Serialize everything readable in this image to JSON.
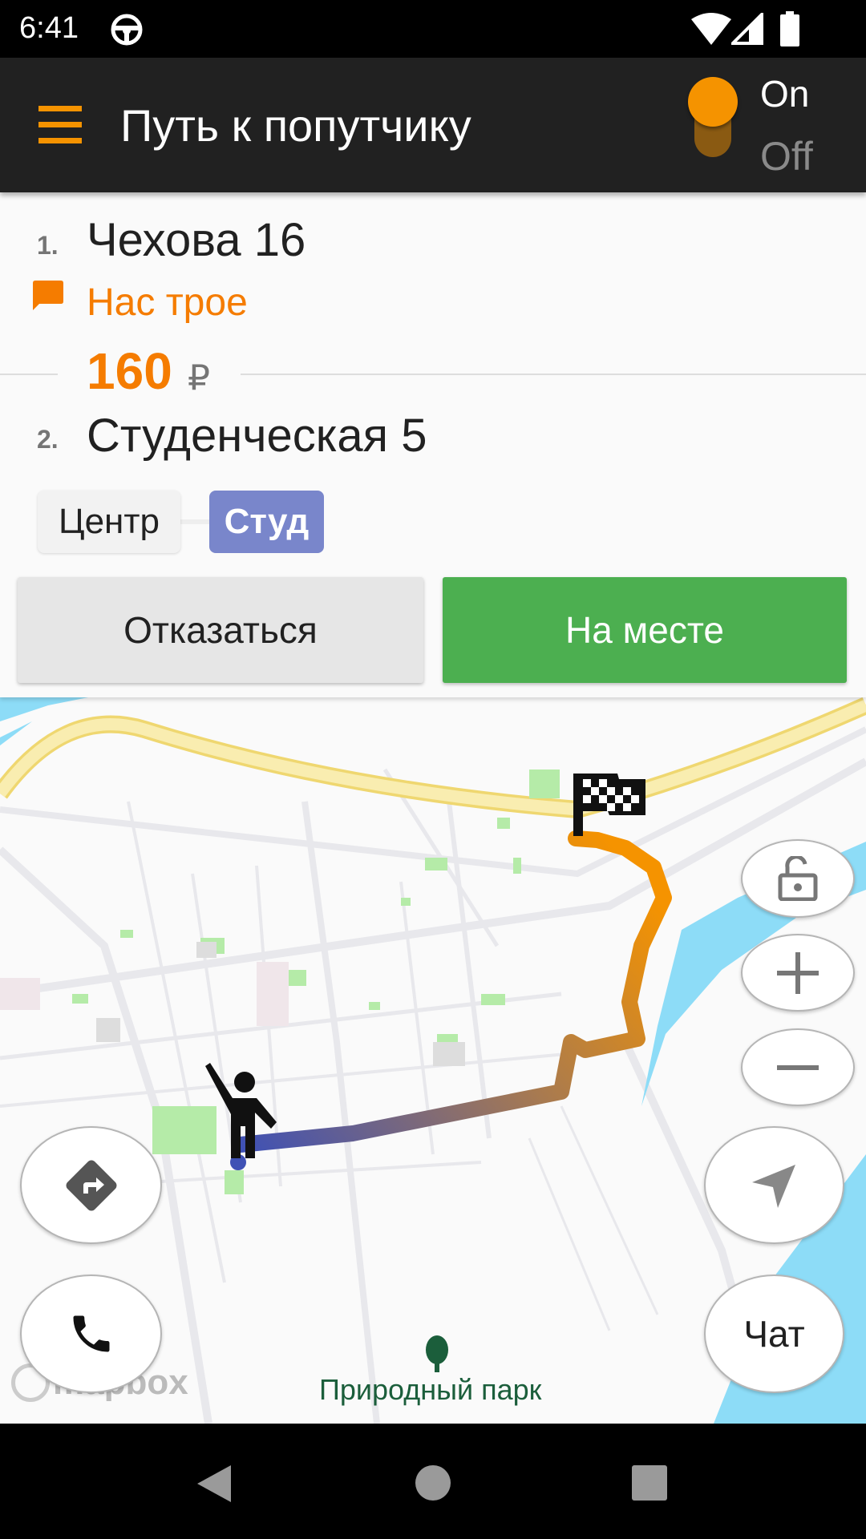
{
  "status_bar": {
    "time": "6:41",
    "icons": [
      "steering-wheel-icon",
      "wifi-icon",
      "signal-icon",
      "battery-icon"
    ]
  },
  "app_bar": {
    "title": "Путь к попутчику",
    "toggle_on_label": "On",
    "toggle_off_label": "Off",
    "toggle_state": "on"
  },
  "trip": {
    "stop1_num": "1.",
    "stop1": "Чехова 16",
    "comment": "Нас трое",
    "price": "160",
    "currency": "₽",
    "stop2_num": "2.",
    "stop2": "Студенческая 5",
    "chips": [
      "Центр",
      "Студ"
    ],
    "decline_label": "Отказаться",
    "arrived_label": "На месте"
  },
  "map": {
    "poi_label": "Природный парк",
    "attribution": "mapbox",
    "chat_label": "Чат",
    "colors": {
      "road_major": "#F7E8A0",
      "water": "#8DDCF7",
      "park": "#B5EBA8",
      "route_start": "#3F51B5",
      "route_end": "#F59300"
    }
  },
  "colors": {
    "accent": "#F59300",
    "appbar": "#212121",
    "arrived": "#4CAF50",
    "chip_active": "#7986CB"
  }
}
